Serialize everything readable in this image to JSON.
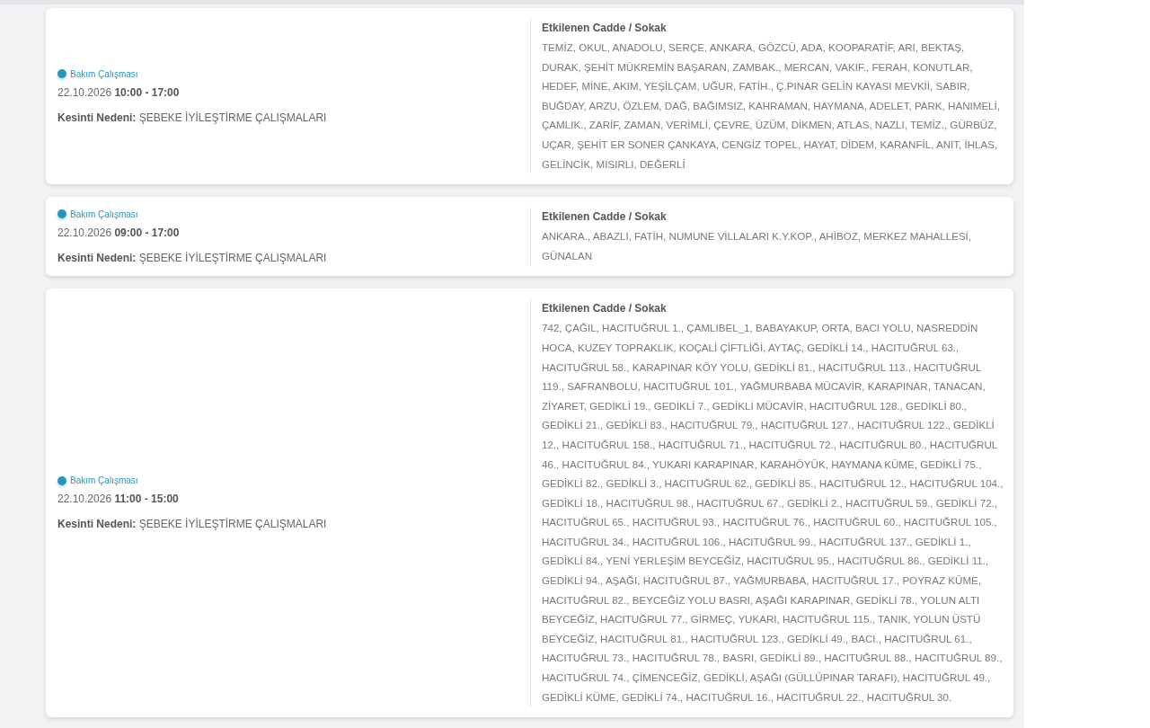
{
  "outages": [
    {
      "status": "Bakım Çalışması",
      "date": "22.10.2026",
      "time": "10:00 - 17:00",
      "reason_label": "Kesinti Nedeni:",
      "reason": "ŞEBEKE İYİLEŞTİRME ÇALIŞMALARI",
      "streets_heading": "Etkilenen Cadde / Sokak",
      "streets": "TEMİZ, OKUL, ANADOLU, SERÇE, ANKARA, GÖZCÜ, ADA, KOOPARATİF, ARI, BEKTAŞ, DURAK, ŞEHİT MÜKREMİN BAŞARAN, ZAMBAK., MERCAN, VAKIF., FERAH, KONUTLAR, HEDEF, MİNE, AKIM, YEŞİLÇAM, UĞUR, FATİH., Ç.PINAR GELİN KAYASI MEVKİİ, SABIR, BUĞDAY, ARZU, ÖZLEM, DAĞ, BAĞIMSIZ, KAHRAMAN, HAYMANA, ADELET, PARK, HANIMELİ, ÇAMLIK., ZARİF, ZAMAN, VERİMLİ, ÇEVRE, ÜZÜM, DİKMEN, ATLAS, NAZLI, TEMİZ., GÜRBÜZ, UÇAR, ŞEHİT ER SONER ÇANKAYA, CENGİZ TOPEL, HAYAT, DİDEM, KARANFİL, ANIT, İHLAS, GELİNCİK, MISIRLI, DEĞERLİ"
    },
    {
      "status": "Bakım Çalışması",
      "date": "22.10.2026",
      "time": "09:00 - 17:00",
      "reason_label": "Kesinti Nedeni:",
      "reason": "ŞEBEKE İYİLEŞTİRME ÇALIŞMALARI",
      "streets_heading": "Etkilenen Cadde / Sokak",
      "streets": "ANKARA., ABAZLI, FATİH, NUMUNE VİLLALARI K.Y.KOP., AHİBOZ, MERKEZ MAHALLESİ, GÜNALAN"
    },
    {
      "status": "Bakım Çalışması",
      "date": "22.10.2026",
      "time": "11:00 - 15:00",
      "reason_label": "Kesinti Nedeni:",
      "reason": "ŞEBEKE İYİLEŞTİRME ÇALIŞMALARI",
      "streets_heading": "Etkilenen Cadde / Sokak",
      "streets": "742, ÇAĞIL, HACITUĞRUL 1., ÇAMLIBEL_1, BABAYAKUP, ORTA, BACI YOLU, NASREDDİN HOCA, KUZEY TOPRAKLIK, KOÇALİ ÇİFTLİĞİ, AYTAÇ, GEDİKLİ 14., HACITUĞRUL 63., HACITUĞRUL 58., KARAPINAR KÖY YOLU, GEDİKLİ 81., HACITUĞRUL 113., HACITUĞRUL 119., SAFRANBOLU, HACITUĞRUL 101., YAĞMURBABA MÜCAVİR, KARAPINAR, TANACAN, ZİYARET, GEDİKLİ 19., GEDİKLİ 7., GEDİKLİ MÜCAVİR, HACITUĞRUL 128., GEDİKLİ 80., GEDİKLİ 21., GEDİKLİ 83., HACITUĞRUL 79., HACITUĞRUL 127., HACITUĞRUL 122., GEDİKLİ 12., HACITUĞRUL 158., HACITUĞRUL 71., HACITUĞRUL 72., HACITUĞRUL 80., HACITUĞRUL 46., HACITUĞRUL 84., YUKARI KARAPINAR, KARAHÖYÜK, HAYMANA KÜME, GEDİKLİ 75., GEDİKLİ 82., GEDİKLİ 3., HACITUĞRUL 62., GEDİKLİ 85., HACITUĞRUL 12., HACITUĞRUL 104., GEDİKLİ 18., HACITUĞRUL 98., HACITUĞRUL 67., GEDİKLİ 2., HACITUĞRUL 59., GEDİKLİ 72., HACITUĞRUL 65., HACITUĞRUL 93., HACITUĞRUL 76., HACITUĞRUL 60., HACITUĞRUL 105., HACITUĞRUL 34., HACITUĞRUL 106., HACITUĞRUL 99., HACITUĞRUL 137., GEDİKLİ 1., GEDİKLİ 84., YENİ YERLEŞİM BEYCEĞİZ, HACITUĞRUL 95., HACITUĞRUL 86., GEDİKLİ 11., GEDİKLİ 94., AŞAĞI, HACITUĞRUL 87., YAĞMURBABA, HACITUĞRUL 17., POYRAZ KÜME, HACITUĞRUL 82., BEYCEĞİZ YOLU BASRI, AŞAĞI KARAPINAR, GEDİKLİ 78., YOLUN ALTI BEYCEĞİZ, HACITUĞRUL 77., GİRMEÇ, YUKARI, HACITUĞRUL 115., TANIK, YOLUN ÜSTÜ BEYCEĞİZ, HACITUĞRUL 81., HACITUĞRUL 123., GEDİKLİ 49., BACI., HACITUĞRUL 61., HACITUĞRUL 73., HACITUĞRUL 78., BASRI, GEDİKLİ 89., HACITUĞRUL 88., HACITUĞRUL 89., HACITUĞRUL 74., ÇİMENCEĞİZ, GEDİKLİ, AŞAĞI (GÜLLÜPINAR TARAFI), HACITUĞRUL 49., GEDİKLİ KÜME, GEDİKLİ 74., HACITUĞRUL 16., HACITUĞRUL 22., HACITUĞRUL 30."
    }
  ]
}
